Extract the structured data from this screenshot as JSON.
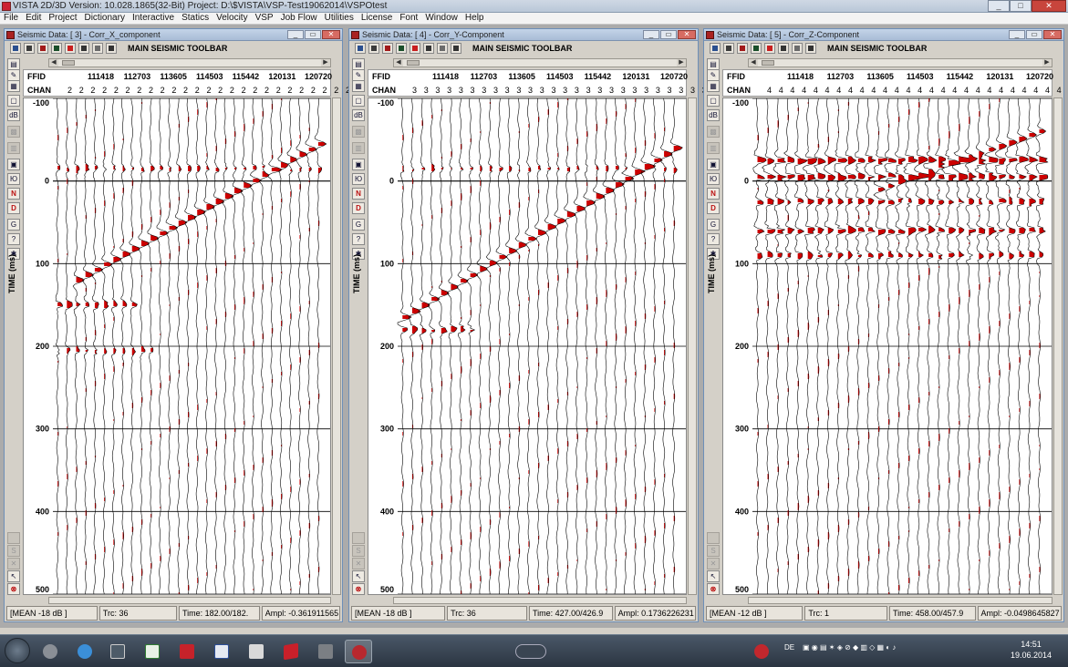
{
  "app": {
    "title": "VISTA 2D/3D Version: 10.028.1865(32-Bit) Project: D:\\$VISTA\\VSP-Test19062014\\VSPOtest",
    "menu": [
      "File",
      "Edit",
      "Project",
      "Dictionary",
      "Interactive",
      "Statics",
      "Velocity",
      "VSP",
      "Job Flow",
      "Utilities",
      "License",
      "Font",
      "Window",
      "Help"
    ]
  },
  "colors": {
    "wiggle_fill": "#cc0000",
    "trace_line": "#000000",
    "panel_bg": "#ffffff"
  },
  "panels": [
    {
      "title": "Seismic Data: [ 3] - Corr_X_component",
      "toolbar_title": "MAIN SEISMIC TOOLBAR",
      "ffid_label": "FFID",
      "chan_label": "CHAN",
      "ffids": [
        "111418",
        "112703",
        "113605",
        "114503",
        "115442",
        "120131",
        "120720"
      ],
      "chan_values": "2 2 2 2 2 2 2 2 2 2 2 2 2 2 2 2 2 2 2 2 2 2 2 2 2 2 2 2 2",
      "y_label": "TIME (ms)",
      "y_ticks": [
        "-100",
        "0",
        "100",
        "200",
        "300",
        "400",
        "500"
      ],
      "status": {
        "mean": "[MEAN -18 dB ]",
        "trc": "Trc: 36",
        "time": "Time: 182.00/182.",
        "ampl": "Ampl: -0.361911565"
      },
      "events": [
        {
          "type": "line",
          "from_trace": 2,
          "to_trace": 28,
          "t_start_ms": 120,
          "t_end_ms": -45,
          "strength": 1.0
        },
        {
          "type": "band",
          "t_ms": -15,
          "strength": 0.35
        },
        {
          "type": "band",
          "t_ms": 150,
          "strength": 0.55,
          "max_trace": 8
        },
        {
          "type": "band",
          "t_ms": 205,
          "strength": 0.35,
          "max_trace": 10
        }
      ]
    },
    {
      "title": "Seismic Data: [ 4] - Corr_Y-Component",
      "toolbar_title": "MAIN SEISMIC TOOLBAR",
      "ffid_label": "FFID",
      "chan_label": "CHAN",
      "ffids": [
        "111418",
        "112703",
        "113605",
        "114503",
        "115442",
        "120131",
        "120720"
      ],
      "chan_values": "3 3 3 3 3 3 3 3 3 3 3 3 3 3 3 3 3 3 3 3 3 3 3 3 3 3 3 3 3",
      "y_label": "TIME (ms)",
      "y_ticks": [
        "-100",
        "0",
        "100",
        "200",
        "300",
        "400",
        "500"
      ],
      "status": {
        "mean": "[MEAN -18 dB ]",
        "trc": "Trc: 36",
        "time": "Time: 427.00/426.9",
        "ampl": "Ampl: 0.1736226231"
      },
      "events": [
        {
          "type": "line",
          "from_trace": 0,
          "to_trace": 28,
          "t_start_ms": 165,
          "t_end_ms": -40,
          "strength": 1.0
        },
        {
          "type": "band",
          "t_ms": -15,
          "strength": 0.3
        },
        {
          "type": "band",
          "t_ms": 180,
          "strength": 0.6,
          "max_trace": 7
        }
      ]
    },
    {
      "title": "Seismic Data: [ 5] - Corr_Z-Component",
      "toolbar_title": "MAIN SEISMIC TOOLBAR",
      "ffid_label": "FFID",
      "chan_label": "CHAN",
      "ffids": [
        "111418",
        "112703",
        "113605",
        "114503",
        "115442",
        "120131",
        "120720"
      ],
      "chan_values": "4 4 4 4 4 4 4 4 4 4 4 4 4 4 4 4 4 4 4 4 4 4 4 4 4 4 4 4 4",
      "y_label": "TIME (ms)",
      "y_ticks": [
        "-100",
        "0",
        "100",
        "200",
        "300",
        "400",
        "500"
      ],
      "status": {
        "mean": "[MEAN -12 dB ]",
        "trc": "Trc: 1",
        "time": "Time: 458.00/457.9",
        "ampl": "Ampl: -0.0498645827"
      },
      "events": [
        {
          "type": "band",
          "t_ms": -25,
          "strength": 1.0
        },
        {
          "type": "band",
          "t_ms": -5,
          "strength": 0.9
        },
        {
          "type": "band",
          "t_ms": 25,
          "strength": 0.7
        },
        {
          "type": "band",
          "t_ms": 60,
          "strength": 0.8
        },
        {
          "type": "band",
          "t_ms": 90,
          "strength": 0.55
        },
        {
          "type": "line",
          "from_trace": 12,
          "to_trace": 28,
          "t_start_ms": 10,
          "t_end_ms": -60,
          "strength": 0.8
        }
      ]
    }
  ],
  "taskbar": {
    "lang": "DE",
    "time": "14:51",
    "date": "19.06.2014"
  }
}
